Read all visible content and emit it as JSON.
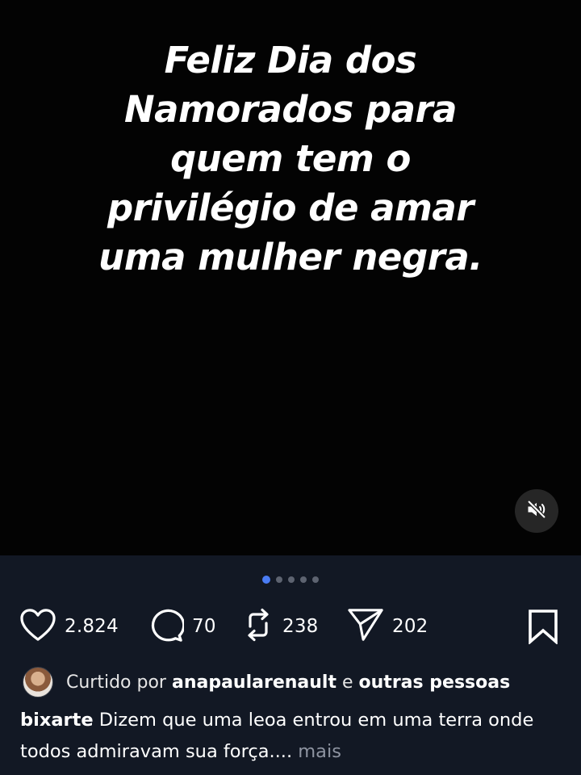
{
  "post": {
    "text": "Feliz Dia dos\nNamorados para\nquem tem o\nprivilégio de amar\numa mulher negra."
  },
  "carousel": {
    "total": 5,
    "active_index": 0
  },
  "actions": {
    "likes": "2.824",
    "comments": "70",
    "reposts": "238",
    "shares": "202"
  },
  "liked_by": {
    "prefix": "Curtido por",
    "user": "anapaularenault",
    "joiner": "e",
    "others": "outras pessoas"
  },
  "caption": {
    "username": "bixarte",
    "text": "Dizem que uma leoa entrou em uma terra onde todos admiravam sua força....",
    "more_label": "mais"
  },
  "colors": {
    "media_bg": "#030303",
    "panel_bg": "#121824",
    "accent_dot": "#4a7cf4"
  },
  "icons": [
    "speaker-muted-icon",
    "heart-icon",
    "comment-icon",
    "repost-icon",
    "send-icon",
    "bookmark-icon"
  ]
}
